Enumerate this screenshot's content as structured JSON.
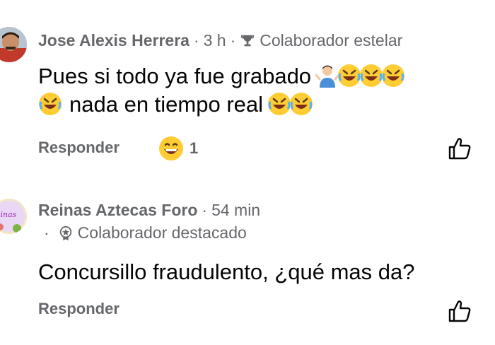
{
  "comments": [
    {
      "author": "Jose Alexis Herrera",
      "time": "3 h",
      "badge": "Colaborador estelar",
      "badge_icon": "trophy-icon",
      "text_line1": "Pues si todo ya fue grabado",
      "text_line2": "nada en tiempo real",
      "reply_label": "Responder",
      "reaction_count": "1",
      "reaction_icon": "grinning-face-icon"
    },
    {
      "author": "Reinas Aztecas Foro",
      "time": "54 min",
      "badge": "Colaborador destacado",
      "badge_icon": "rising-star-icon",
      "text": "Concursillo fraudulento, ¿qué mas da?",
      "reply_label": "Responder"
    }
  ],
  "colors": {
    "meta_gray": "#65676b",
    "text": "#050505",
    "emoji_yellow": "#ffcc33"
  }
}
